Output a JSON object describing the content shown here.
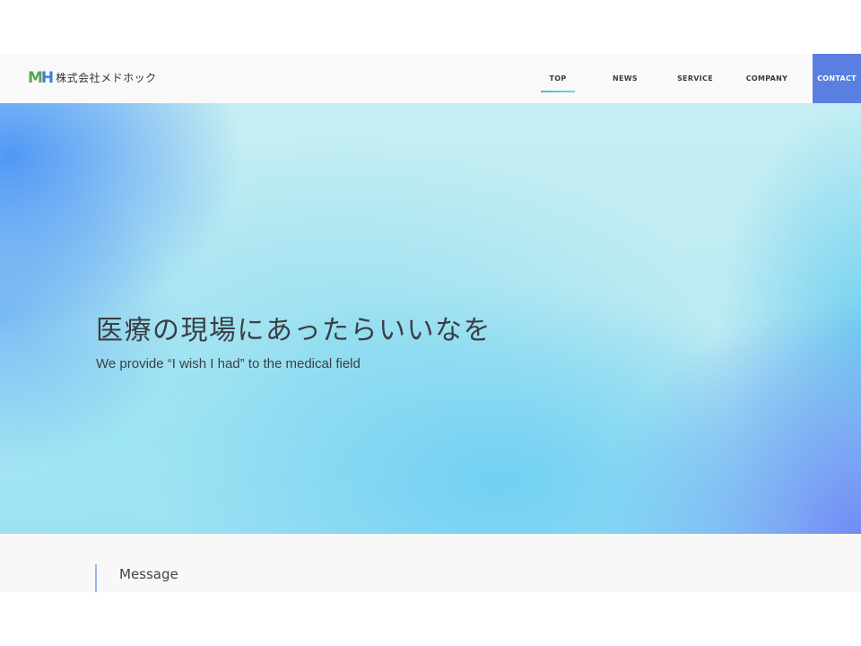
{
  "header": {
    "logo_mark": "MH",
    "company_name": "株式会社メドホック",
    "colors": {
      "logo_m": "#5aa651",
      "logo_h": "#3f7fd8",
      "contact_bg": "#5b7fe0",
      "underline": "#5aaee0"
    },
    "nav": {
      "active": "TOP",
      "items": [
        {
          "label": "TOP"
        },
        {
          "label": "NEWS"
        },
        {
          "label": "SERVICE"
        },
        {
          "label": "COMPANY"
        }
      ],
      "contact_label": "CONTACT"
    }
  },
  "hero": {
    "title": "医療の現場にあったらいいなを",
    "subtitle": "We provide “I wish I had” to the medical field"
  },
  "message": {
    "heading": "Message"
  }
}
